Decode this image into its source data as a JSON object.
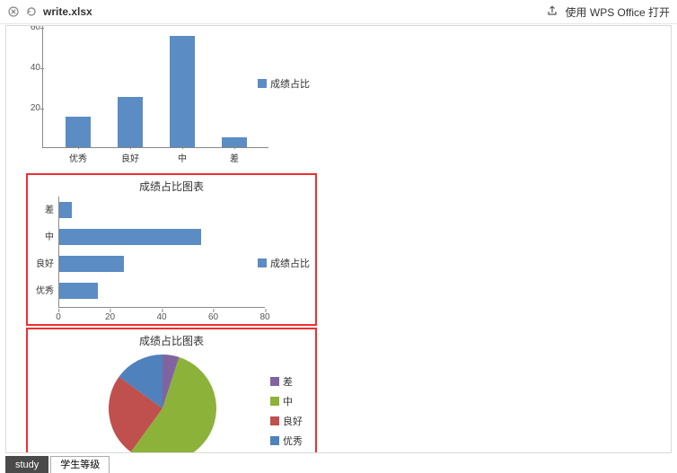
{
  "titlebar": {
    "filename": "write.xlsx",
    "open_with": "使用 WPS Office 打开"
  },
  "charts": {
    "c1": {
      "legend": "成绩占比",
      "yticks": [
        "20",
        "40",
        "60"
      ]
    },
    "c2": {
      "title": "成绩占比图表",
      "legend": "成绩占比",
      "xticks": [
        "0",
        "20",
        "40",
        "60",
        "80"
      ]
    },
    "c3": {
      "title": "成绩占比图表",
      "legend": [
        "差",
        "中",
        "良好",
        "优秀"
      ]
    },
    "categories": [
      "优秀",
      "良好",
      "中",
      "差"
    ]
  },
  "tabs": {
    "active": "study",
    "other": "学生等级"
  },
  "chart_data": [
    {
      "type": "bar",
      "title": "",
      "categories": [
        "优秀",
        "良好",
        "中",
        "差"
      ],
      "series": [
        {
          "name": "成绩占比",
          "values": [
            15,
            25,
            55,
            5
          ]
        }
      ],
      "xlabel": "",
      "ylabel": "",
      "ylim": [
        0,
        60
      ]
    },
    {
      "type": "bar",
      "orientation": "horizontal",
      "title": "成绩占比图表",
      "categories": [
        "差",
        "中",
        "良好",
        "优秀"
      ],
      "series": [
        {
          "name": "成绩占比",
          "values": [
            5,
            55,
            25,
            15
          ]
        }
      ],
      "xlabel": "",
      "ylabel": "",
      "xlim": [
        0,
        80
      ]
    },
    {
      "type": "pie",
      "title": "成绩占比图表",
      "categories": [
        "差",
        "中",
        "良好",
        "优秀"
      ],
      "values": [
        5,
        55,
        25,
        15
      ],
      "colors": [
        "#8064a2",
        "#8db23a",
        "#c0504d",
        "#4f81bd"
      ]
    }
  ]
}
